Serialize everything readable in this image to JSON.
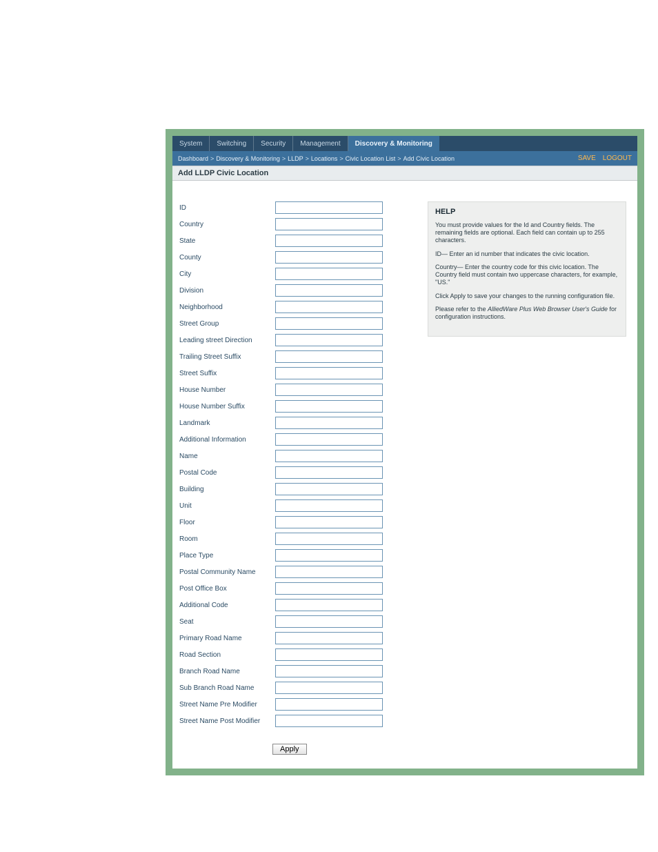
{
  "tabs": {
    "system": "System",
    "switching": "Switching",
    "security": "Security",
    "management": "Management",
    "discovery": "Discovery & Monitoring"
  },
  "breadcrumb": {
    "items": [
      "Dashboard",
      "Discovery & Monitoring",
      "LLDP",
      "Locations",
      "Civic Location List",
      "Add Civic Location"
    ]
  },
  "actions": {
    "save": "SAVE",
    "logout": "LOGOUT"
  },
  "panel_title": "Add LLDP Civic Location",
  "fields": [
    {
      "key": "id",
      "label": "ID"
    },
    {
      "key": "country",
      "label": "Country"
    },
    {
      "key": "state",
      "label": "State"
    },
    {
      "key": "county",
      "label": "County"
    },
    {
      "key": "city",
      "label": "City"
    },
    {
      "key": "division",
      "label": "Division"
    },
    {
      "key": "neighborhood",
      "label": "Neighborhood"
    },
    {
      "key": "street_group",
      "label": "Street Group"
    },
    {
      "key": "leading_street_direction",
      "label": "Leading street Direction"
    },
    {
      "key": "trailing_street_suffix",
      "label": "Trailing Street Suffix"
    },
    {
      "key": "street_suffix",
      "label": "Street Suffix"
    },
    {
      "key": "house_number",
      "label": "House Number"
    },
    {
      "key": "house_number_suffix",
      "label": "House Number Suffix"
    },
    {
      "key": "landmark",
      "label": "Landmark"
    },
    {
      "key": "additional_information",
      "label": "Additional Information"
    },
    {
      "key": "name",
      "label": "Name"
    },
    {
      "key": "postal_code",
      "label": "Postal Code"
    },
    {
      "key": "building",
      "label": "Building"
    },
    {
      "key": "unit",
      "label": "Unit"
    },
    {
      "key": "floor",
      "label": "Floor"
    },
    {
      "key": "room",
      "label": "Room"
    },
    {
      "key": "place_type",
      "label": "Place Type"
    },
    {
      "key": "postal_community_name",
      "label": "Postal Community Name"
    },
    {
      "key": "post_office_box",
      "label": "Post Office Box"
    },
    {
      "key": "additional_code",
      "label": "Additional Code"
    },
    {
      "key": "seat",
      "label": "Seat"
    },
    {
      "key": "primary_road_name",
      "label": "Primary Road Name"
    },
    {
      "key": "road_section",
      "label": "Road Section"
    },
    {
      "key": "branch_road_name",
      "label": "Branch Road Name"
    },
    {
      "key": "sub_branch_road_name",
      "label": "Sub Branch Road Name"
    },
    {
      "key": "street_name_pre_modifier",
      "label": "Street Name Pre Modifier"
    },
    {
      "key": "street_name_post_modifier",
      "label": "Street Name Post Modifier"
    }
  ],
  "apply_label": "Apply",
  "help": {
    "title": "HELP",
    "p1": "You must provide values for the Id and Country fields. The remaining fields are optional. Each field can contain up to 255 characters.",
    "p2": "ID— Enter an id number that indicates the civic location.",
    "p3": "Country— Enter the country code for this civic location. The Country field must contain two uppercase characters, for example, \"US.\"",
    "p4": "Click Apply to save your changes to the running configuration file.",
    "p5_pre": "Please refer to the ",
    "p5_em": "AlliedWare Plus Web Browser User's Guide",
    "p5_post": " for configuration instructions."
  }
}
